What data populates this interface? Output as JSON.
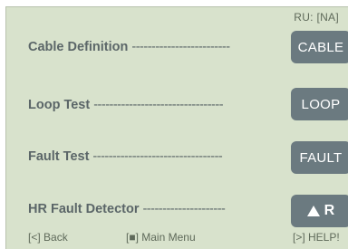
{
  "header": {
    "ru_status": "RU: [NA]"
  },
  "menu": {
    "items": [
      {
        "label": "Cable Definition",
        "dashes": "-------------------------",
        "button": "CABLE"
      },
      {
        "label": "Loop Test",
        "dashes": "---------------------------------",
        "button": "LOOP"
      },
      {
        "label": "Fault Test",
        "dashes": "---------------------------------",
        "button": "FAULT"
      },
      {
        "label": "HR Fault Detector",
        "dashes": "---------------------",
        "button": "R",
        "button_icon": "triangle-up-icon"
      }
    ]
  },
  "footer": {
    "back": "[<] Back",
    "main_menu": "[■] Main Menu",
    "help": "[>] HELP!"
  }
}
